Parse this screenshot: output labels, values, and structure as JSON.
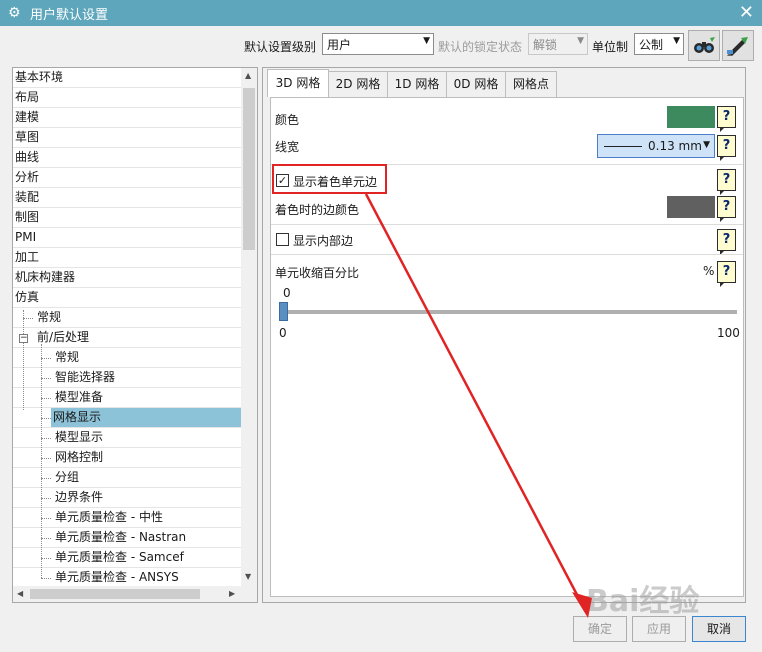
{
  "window": {
    "title": "用户默认设置",
    "close_glyph": "✕"
  },
  "toolbar": {
    "level_label": "默认设置级别",
    "level_value": "用户",
    "lock_label": "默认的锁定状态",
    "lock_value": "解锁",
    "unit_label": "单位制",
    "unit_value": "公制"
  },
  "tree": {
    "items": [
      {
        "label": "基本环境"
      },
      {
        "label": "布局"
      },
      {
        "label": "建模"
      },
      {
        "label": "草图"
      },
      {
        "label": "曲线"
      },
      {
        "label": "分析"
      },
      {
        "label": "装配"
      },
      {
        "label": "制图"
      },
      {
        "label": "PMI"
      },
      {
        "label": "加工"
      },
      {
        "label": "机床构建器"
      },
      {
        "label": "仿真"
      },
      {
        "label": "常规"
      },
      {
        "label": "前/后处理"
      },
      {
        "label": "常规"
      },
      {
        "label": "智能选择器"
      },
      {
        "label": "模型准备"
      },
      {
        "label": "网格显示"
      },
      {
        "label": "模型显示"
      },
      {
        "label": "网格控制"
      },
      {
        "label": "分组"
      },
      {
        "label": "边界条件"
      },
      {
        "label": "单元质量检查 - 中性"
      },
      {
        "label": "单元质量检查 - Nastran"
      },
      {
        "label": "单元质量检查 - Samcef"
      },
      {
        "label": "单元质量检查 - ANSYS"
      }
    ],
    "expander_glyph": "−"
  },
  "tabs": [
    {
      "label": "3D 网格"
    },
    {
      "label": "2D 网格"
    },
    {
      "label": "1D 网格"
    },
    {
      "label": "0D 网格"
    },
    {
      "label": "网格点"
    }
  ],
  "settings": {
    "color_label": "颜色",
    "color_value": "#3d8a5f",
    "linewidth_label": "线宽",
    "linewidth_value": "0.13 mm",
    "show_shaded_edges_label": "显示着色单元边",
    "show_shaded_edges_checked": true,
    "check_glyph": "✓",
    "shaded_edge_color_label": "着色时的边颜色",
    "shaded_edge_color_value": "#606060",
    "show_inner_edges_label": "显示内部边",
    "show_inner_edges_checked": false,
    "shrink_label": "单元收缩百分比",
    "shrink_unit": "%",
    "shrink_value": "0",
    "shrink_min": "0",
    "shrink_max": "100",
    "help_glyph": "?"
  },
  "buttons": {
    "ok": "确定",
    "apply": "应用",
    "cancel": "取消"
  },
  "watermark": "Bai经验",
  "colors": {
    "titlebar": "#5ea6bc",
    "selection": "#8dc3d8",
    "annotation": "#e02424"
  }
}
